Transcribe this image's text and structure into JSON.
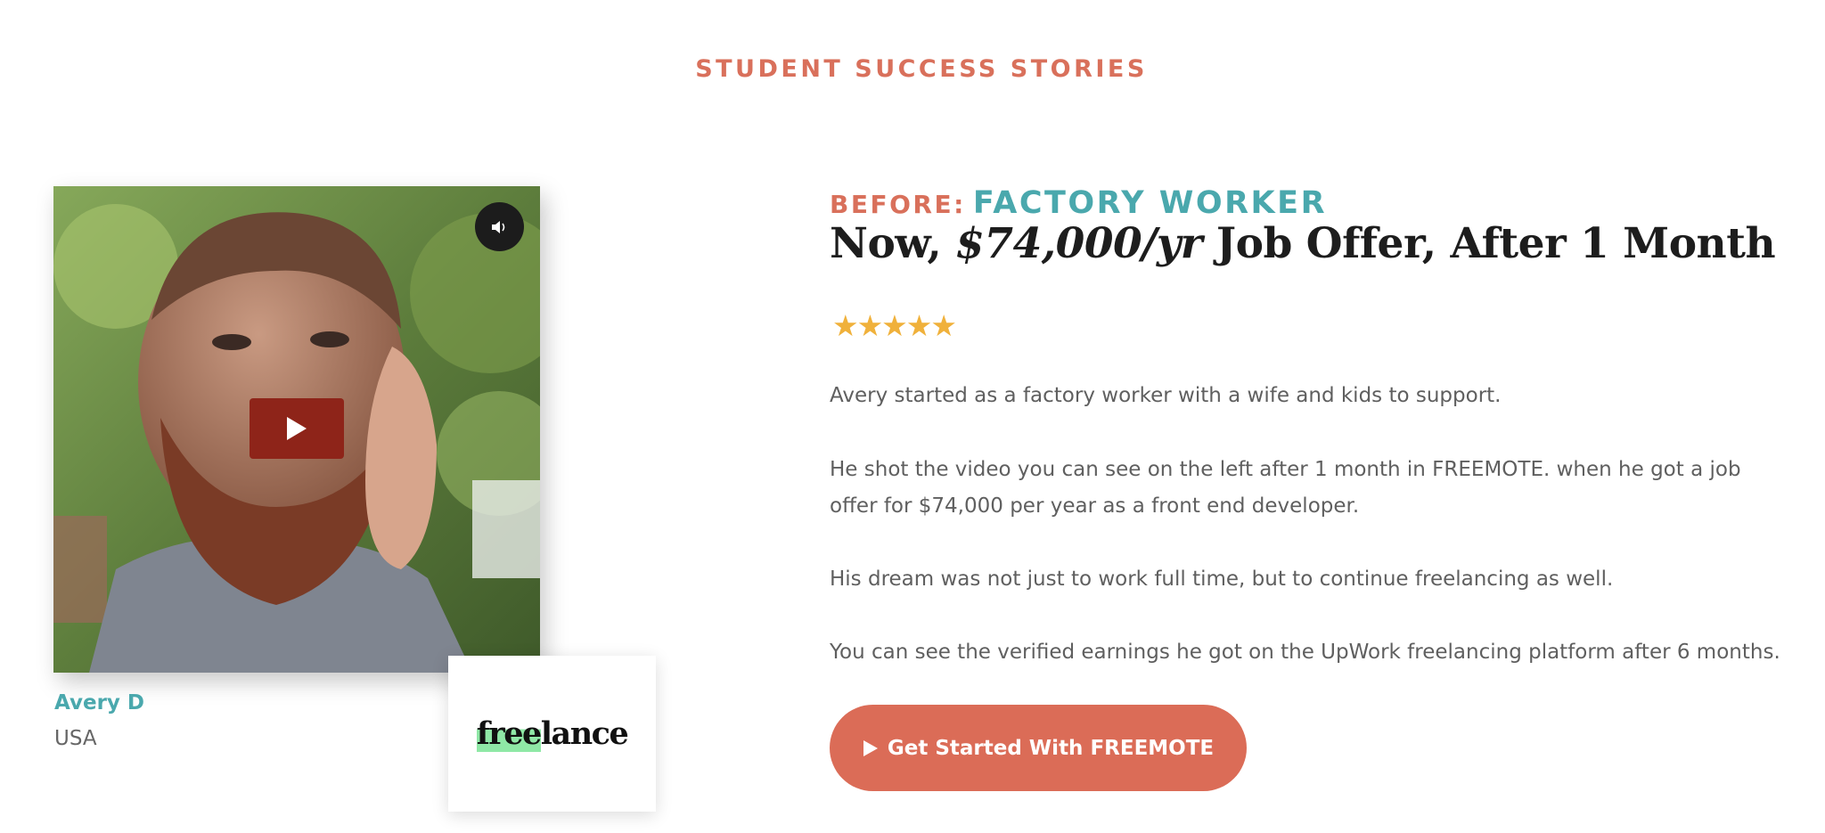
{
  "section": {
    "label": "STUDENT SUCCESS STORIES"
  },
  "video": {
    "sound_icon": "speaker-icon",
    "play_icon": "play-icon"
  },
  "student": {
    "name": "Avery D",
    "country": "USA"
  },
  "logo": {
    "text_highlight": "free",
    "text_rest": "lance",
    "highlight_color": "#8fe8a6"
  },
  "story": {
    "before_label": "BEFORE:",
    "before_value": "FACTORY WORKER",
    "headline_prefix": "Now, ",
    "headline_salary": "$74,000/yr",
    "headline_suffix": " Job Offer, After 1 Month",
    "rating_stars": "★★★★★",
    "rating": 5,
    "paragraphs": [
      "Avery started as a factory worker with a wife and kids to support.",
      "He shot the video you can see on the left after 1 month in FREEMOTE. when he got a job offer for $74,000 per year as a front end developer.",
      "His dream was not just to work full time, but to continue freelancing as well.",
      "You can see the verified earnings he got on the UpWork freelancing platform after 6 months."
    ]
  },
  "cta": {
    "icon": "play-icon",
    "label": "Get Started With FREEMOTE"
  },
  "colors": {
    "accent_coral": "#d9705b",
    "accent_teal": "#4aa8ad",
    "star": "#f0b13b",
    "button": "#db6c57"
  }
}
